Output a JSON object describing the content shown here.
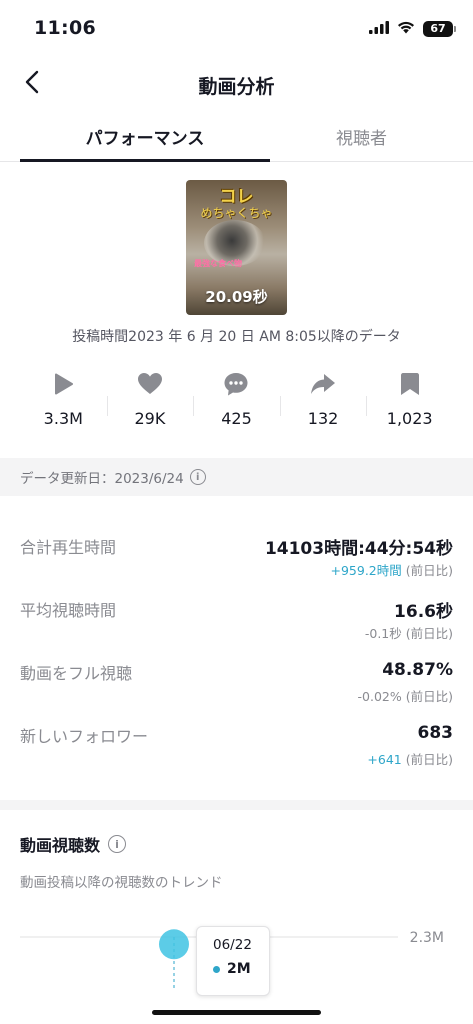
{
  "status_bar": {
    "time": "11:06",
    "battery": "67",
    "icons": [
      "signal-icon",
      "wifi-icon",
      "battery-icon"
    ]
  },
  "nav": {
    "title": "動画分析",
    "back_icon": "chevron-left-icon"
  },
  "tabs": [
    {
      "label": "パフォーマンス",
      "active": true
    },
    {
      "label": "視聴者",
      "active": false
    }
  ],
  "video": {
    "thumb_text_1": "コレ",
    "thumb_text_2": "めちゃくちゃ",
    "thumb_text_3": "最強な食べ物",
    "duration": "20.09秒"
  },
  "post_time": "投稿時間2023 年 6 月 20 日 AM 8:05以降のデータ",
  "stats": [
    {
      "icon": "play-icon",
      "value": "3.3M"
    },
    {
      "icon": "heart-icon",
      "value": "29K"
    },
    {
      "icon": "comment-icon",
      "value": "425"
    },
    {
      "icon": "share-icon",
      "value": "132"
    },
    {
      "icon": "bookmark-icon",
      "value": "1,023"
    }
  ],
  "update": {
    "text": "データ更新日：2023/6/24",
    "icon": "info-icon"
  },
  "metrics": [
    {
      "label": "合計再生時間",
      "value": "14103時間:44分:54秒",
      "delta": "+959.2時間",
      "delta_suffix": " (前日比)",
      "delta_positive": true
    },
    {
      "label": "平均視聴時間",
      "value": "16.6秒",
      "delta": "-0.1秒",
      "delta_suffix": " (前日比)",
      "delta_positive": false
    },
    {
      "label": "動画をフル視聴",
      "value": "48.87%",
      "delta": "-0.02%",
      "delta_suffix": " (前日比)",
      "delta_positive": false
    },
    {
      "label": "新しいフォロワー",
      "value": "683",
      "delta": "+641",
      "delta_suffix": " (前日比)",
      "delta_positive": true
    }
  ],
  "views_section": {
    "title": "動画視聴数",
    "subtitle": "動画投稿以降の視聴数のトレンド",
    "info_icon": "info-icon"
  },
  "chart_data": {
    "type": "line",
    "title": "",
    "y_tick_labels": [
      "2.3M"
    ],
    "points": [
      {
        "x": "06/22",
        "y": 2000000
      }
    ],
    "series": [
      {
        "values": [
          2000000
        ],
        "color": "#2ea6c9"
      }
    ],
    "tooltip": {
      "date": "06/22",
      "value": "2M"
    }
  },
  "colors": {
    "accent": "#2ea6c9",
    "text_primary": "#161823",
    "text_secondary": "#8a8b91"
  }
}
